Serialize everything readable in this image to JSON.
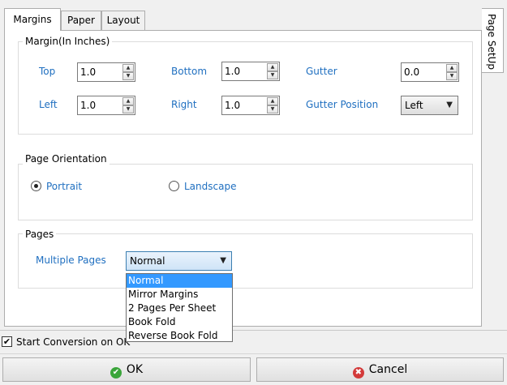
{
  "tabs": [
    "Margins",
    "Paper",
    "Layout"
  ],
  "side_tab": "Page SetUp",
  "margin_group": {
    "title": "Margin(In Inches)",
    "top": {
      "label": "Top",
      "value": "1.0"
    },
    "bottom": {
      "label": "Bottom",
      "value": "1.0"
    },
    "gutter": {
      "label": "Gutter",
      "value": "0.0"
    },
    "left": {
      "label": "Left",
      "value": "1.0"
    },
    "right": {
      "label": "Right",
      "value": "1.0"
    },
    "gutter_position": {
      "label": "Gutter Position",
      "value": "Left"
    }
  },
  "orientation_group": {
    "title": "Page Orientation",
    "portrait": "Portrait",
    "landscape": "Landscape",
    "selected": "Portrait"
  },
  "pages_group": {
    "title": "Pages",
    "label": "Multiple Pages",
    "selected": "Normal",
    "options": [
      "Normal",
      "Mirror Margins",
      "2 Pages Per Sheet",
      "Book Fold",
      "Reverse Book Fold"
    ]
  },
  "start_conversion": {
    "label": "Start Conversion on OK",
    "checked": true
  },
  "buttons": {
    "ok": "OK",
    "cancel": "Cancel"
  },
  "colors": {
    "label_blue": "#1f6fc0",
    "selection": "#3399ff",
    "ok_icon": "#3aa53a",
    "cancel_icon": "#d33a3a"
  }
}
